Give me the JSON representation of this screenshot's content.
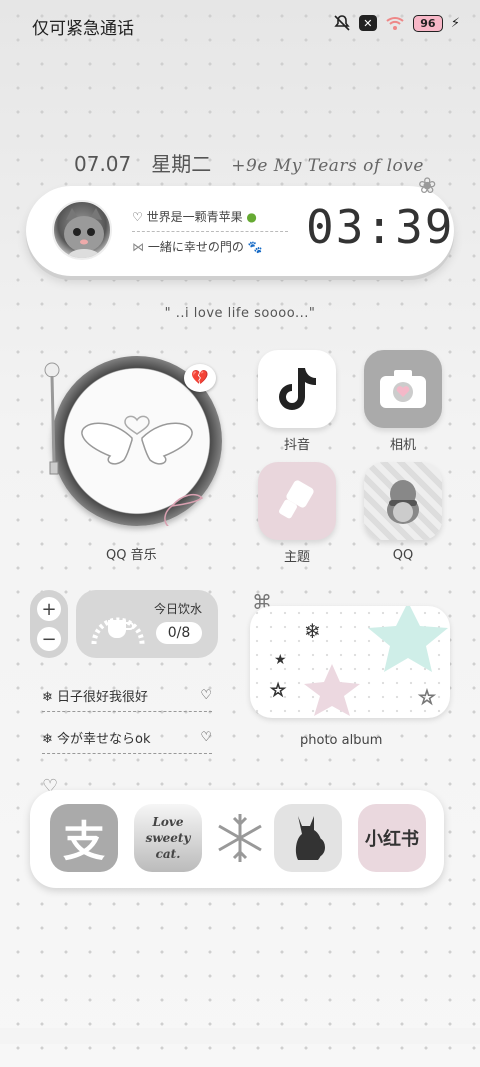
{
  "status_bar": {
    "carrier": "仅可紧急通话",
    "battery": "96"
  },
  "date_widget": {
    "date": "07.07",
    "weekday": "星期二",
    "motto": "+9e My Tears of love"
  },
  "time_widget": {
    "line1": "♡ 世界是一颗青苹果",
    "line2": "一緒に幸せの門の",
    "time": "03:39"
  },
  "quote": "\" ..i love life soooo...\"",
  "music_widget": {
    "label": "QQ 音乐"
  },
  "apps": [
    {
      "label": "抖音"
    },
    {
      "label": "相机"
    },
    {
      "label": "主题"
    },
    {
      "label": "QQ"
    }
  ],
  "water_widget": {
    "title": "今日饮水",
    "count": "0/8",
    "plus": "+",
    "minus": "−"
  },
  "notes": [
    {
      "text": "日子很好我很好",
      "icon": "snowflake-icon"
    },
    {
      "text": "今が幸せならok",
      "icon": "snowflake-icon"
    }
  ],
  "photo_album": {
    "label": "photo album"
  },
  "dock": {
    "alipay_glyph": "支",
    "love_text": "Love sweety cat.",
    "xhs_text": "小红书"
  }
}
